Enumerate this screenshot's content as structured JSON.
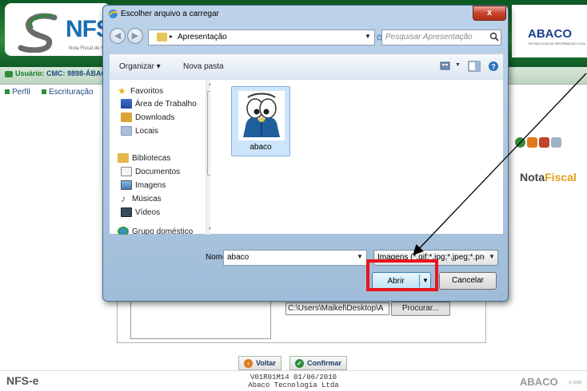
{
  "app": {
    "logo_text": "NFS",
    "logo_subtitle": "Nota Fiscal de S",
    "vendor_logo": "ABACO",
    "vendor_tagline": "TECNOLOGIA DE INFORMAÇÃO LTDA",
    "user_label": "Usuário:",
    "user_value": "CMC: 9898-ÁBAC",
    "menu": [
      {
        "label": "Perfil"
      },
      {
        "label": "Escrituração"
      }
    ],
    "brand_right_a": "Nota",
    "brand_right_b": "Fiscal",
    "path_value": "C:\\Users\\Maikel\\Desktop\\A",
    "browse_label": "Procurar...",
    "back_label": "Voltar",
    "confirm_label": "Confirmar",
    "footer_logo": "NFS-e",
    "footer_version": "V01R01M14 01/06/2010",
    "footer_company": "Abaco Tecnologia Ltda",
    "footer_vendor": "ABACO",
    "footer_copy": "© 2008",
    "colors": {
      "header_green": "#2c8a3a",
      "link_blue": "#1b4b80",
      "highlight_red": "#e8141b"
    }
  },
  "dialog": {
    "title": "Escolher arquivo a carregar",
    "close_label": "x",
    "breadcrumb": "Apresentação",
    "search_placeholder": "Pesquisar Apresentação",
    "toolbar": {
      "organize": "Organizar ▾",
      "new_folder": "Nova pasta"
    },
    "nav": [
      {
        "label": "Favoritos",
        "icon": "star-icon"
      },
      {
        "label": "Área de Trabalho",
        "icon": "desktop-icon"
      },
      {
        "label": "Downloads",
        "icon": "downloads-icon"
      },
      {
        "label": "Locais",
        "icon": "recent-places-icon"
      },
      {
        "label": "Bibliotecas",
        "icon": "libraries-icon"
      },
      {
        "label": "Documentos",
        "icon": "documents-icon"
      },
      {
        "label": "Imagens",
        "icon": "pictures-icon"
      },
      {
        "label": "Músicas",
        "icon": "music-icon"
      },
      {
        "label": "Vídeos",
        "icon": "videos-icon"
      },
      {
        "label": "Grupo doméstico",
        "icon": "homegroup-icon"
      }
    ],
    "file": {
      "name": "abaco"
    },
    "name_label": "Nome:",
    "name_value": "abaco",
    "filter_value": "Imagens (*.gif;*.jpg;*.jpeg;*.png",
    "open_label": "Abrir",
    "cancel_label": "Cancelar"
  }
}
